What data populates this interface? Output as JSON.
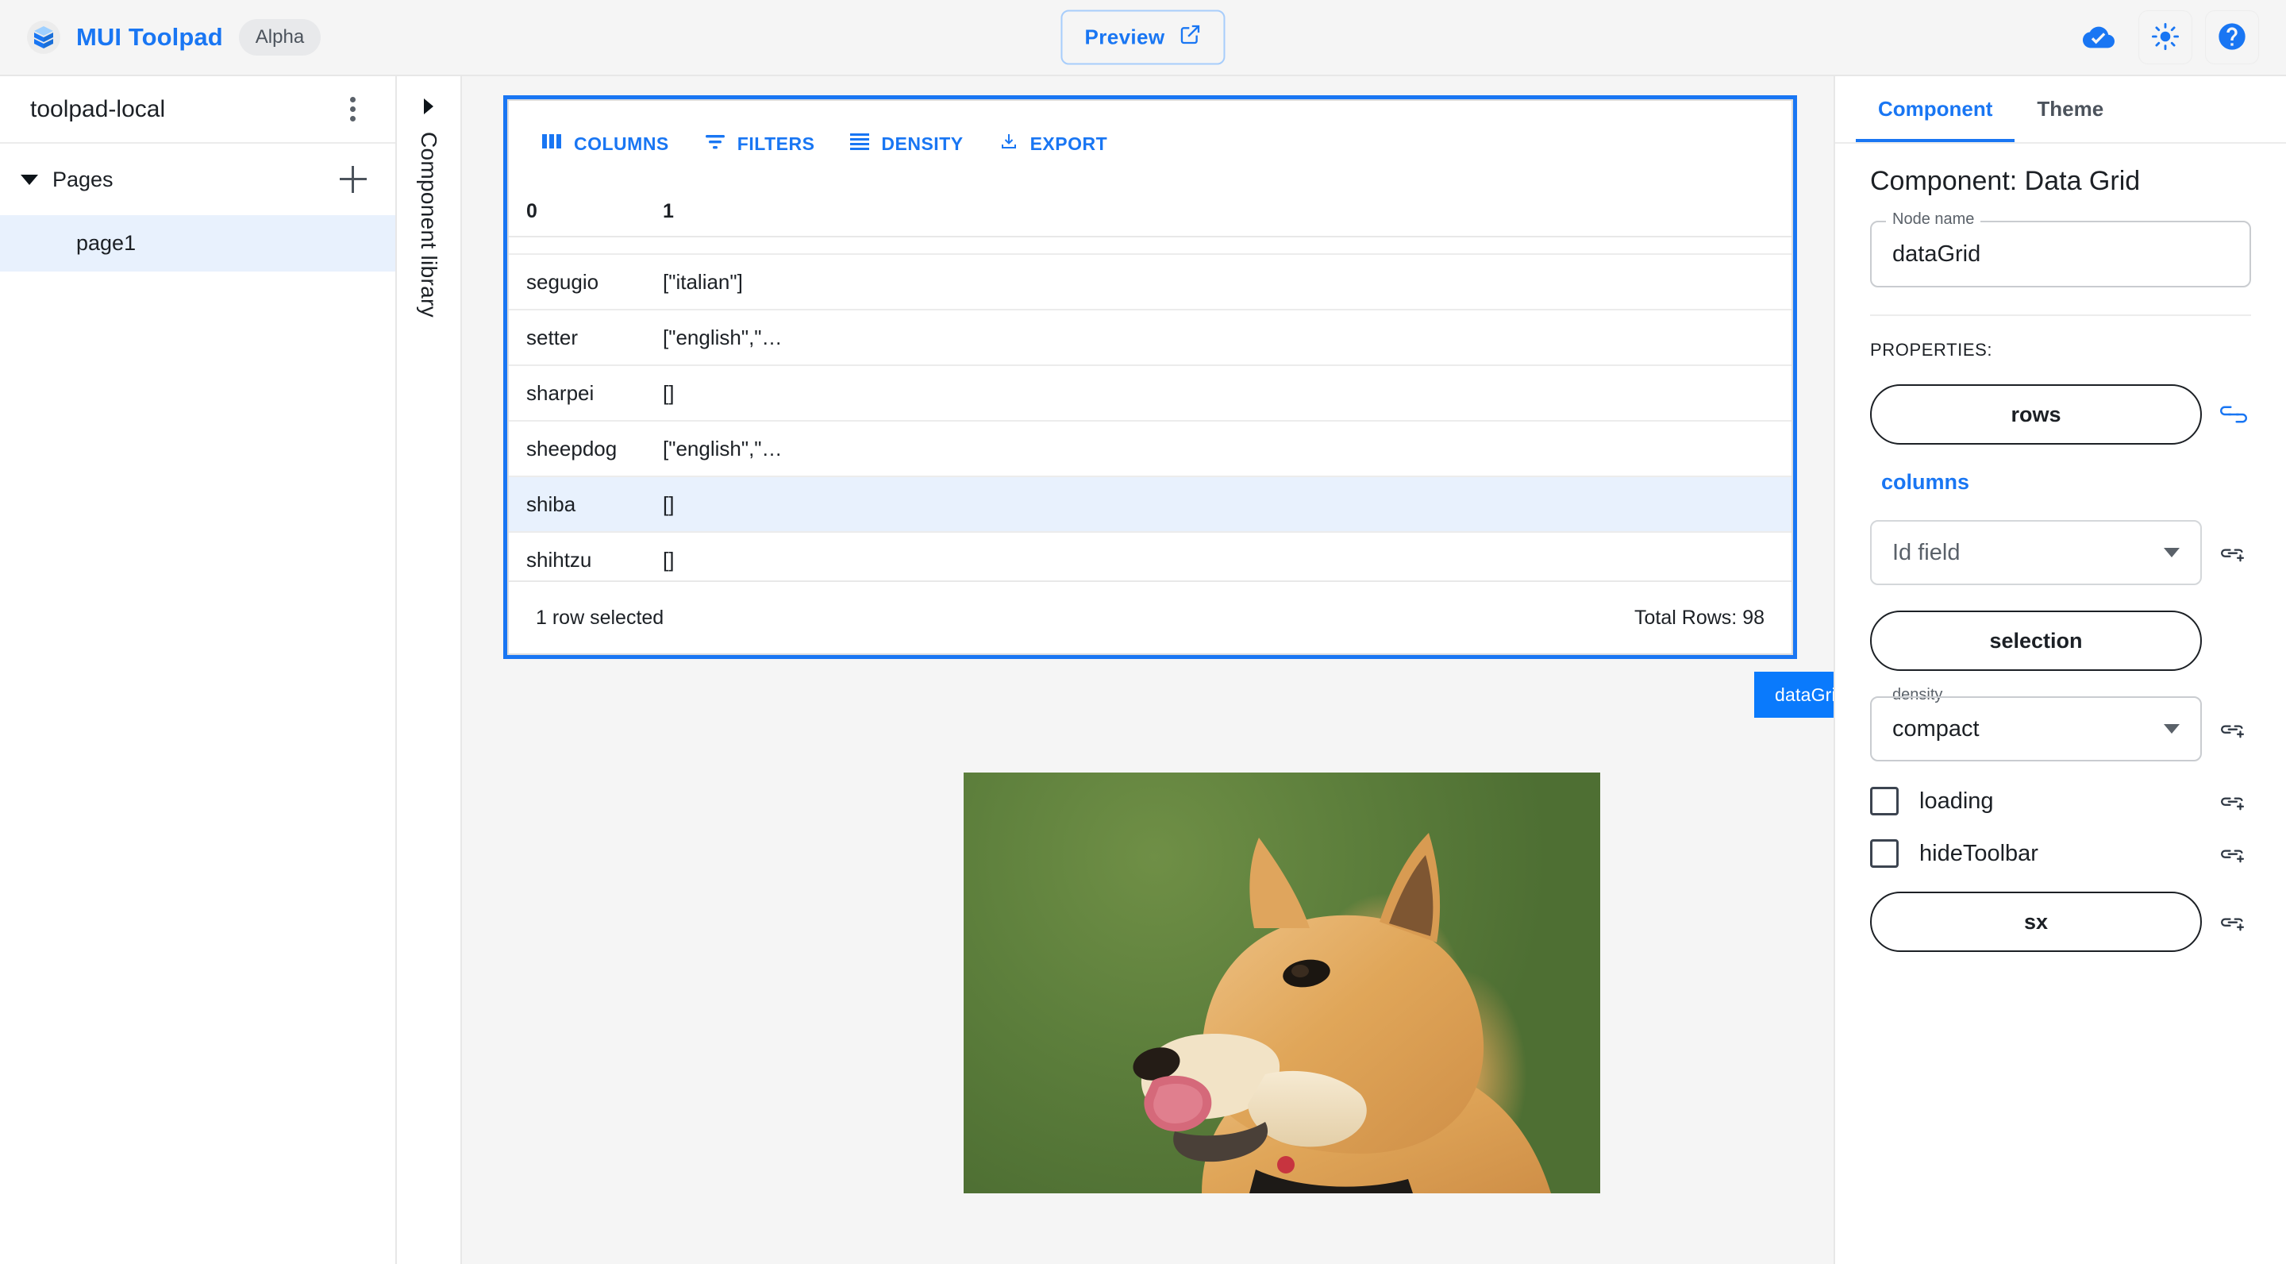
{
  "topbar": {
    "brand_title": "MUI Toolpad",
    "version_chip": "Alpha",
    "preview_label": "Preview",
    "icons": {
      "logo": "toolpad-logo-icon",
      "preview_external": "open-in-new-icon",
      "cloud": "cloud-done-icon",
      "theme": "light-mode-sun-icon",
      "help": "help-circle-icon"
    }
  },
  "sidebar": {
    "project_name": "toolpad-local",
    "more_icon": "kebab-menu-icon",
    "tree": {
      "group_label": "Pages",
      "add_icon": "plus-icon",
      "expand_icon": "caret-down-icon",
      "items": [
        {
          "label": "page1",
          "selected": true
        }
      ]
    }
  },
  "component_library": {
    "label": "Component library",
    "expand_icon": "caret-right-icon"
  },
  "data_grid": {
    "toolbar": [
      {
        "label": "COLUMNS",
        "icon": "columns-icon"
      },
      {
        "label": "FILTERS",
        "icon": "filter-icon"
      },
      {
        "label": "DENSITY",
        "icon": "density-icon"
      },
      {
        "label": "EXPORT",
        "icon": "download-icon"
      }
    ],
    "columns": [
      "0",
      "1"
    ],
    "rows": [
      {
        "c0": "segugio",
        "c1": "[\"italian\"]",
        "selected": false
      },
      {
        "c0": "setter",
        "c1": "[\"english\",\"…",
        "selected": false
      },
      {
        "c0": "sharpei",
        "c1": "[]",
        "selected": false
      },
      {
        "c0": "sheepdog",
        "c1": "[\"english\",\"…",
        "selected": false
      },
      {
        "c0": "shiba",
        "c1": "[]",
        "selected": true
      },
      {
        "c0": "shihtzu",
        "c1": "[]",
        "selected": false
      }
    ],
    "footer_selected": "1 row selected",
    "footer_total": "Total Rows: 98"
  },
  "node_toolbar": {
    "name": "dataGrid",
    "drag_icon": "drag-handle-icon",
    "duplicate_icon": "copy-icon",
    "delete_icon": "trash-icon"
  },
  "image_component": {
    "alt": "shiba-inu-dog-photo"
  },
  "inspector": {
    "tabs": [
      {
        "label": "Component",
        "active": true
      },
      {
        "label": "Theme",
        "active": false
      }
    ],
    "title": "Component: Data Grid",
    "node_name_label": "Node name",
    "node_name_value": "dataGrid",
    "properties_label": "PROPERTIES:",
    "properties": {
      "rows_label": "rows",
      "columns_label": "columns",
      "id_field_placeholder": "Id field",
      "selection_label": "selection",
      "density_label": "density",
      "density_value": "compact",
      "loading_label": "loading",
      "hide_toolbar_label": "hideToolbar",
      "sx_label": "sx"
    },
    "icons": {
      "bound_link": "link-connected-icon",
      "add_binding": "add-link-icon",
      "dropdown": "chevron-down-icon"
    }
  },
  "colors": {
    "accent": "#1976f3",
    "selection_blue": "#0a7afc",
    "row_selected_bg": "#e8f1fd",
    "canvas_bg": "#f5f5f5"
  }
}
